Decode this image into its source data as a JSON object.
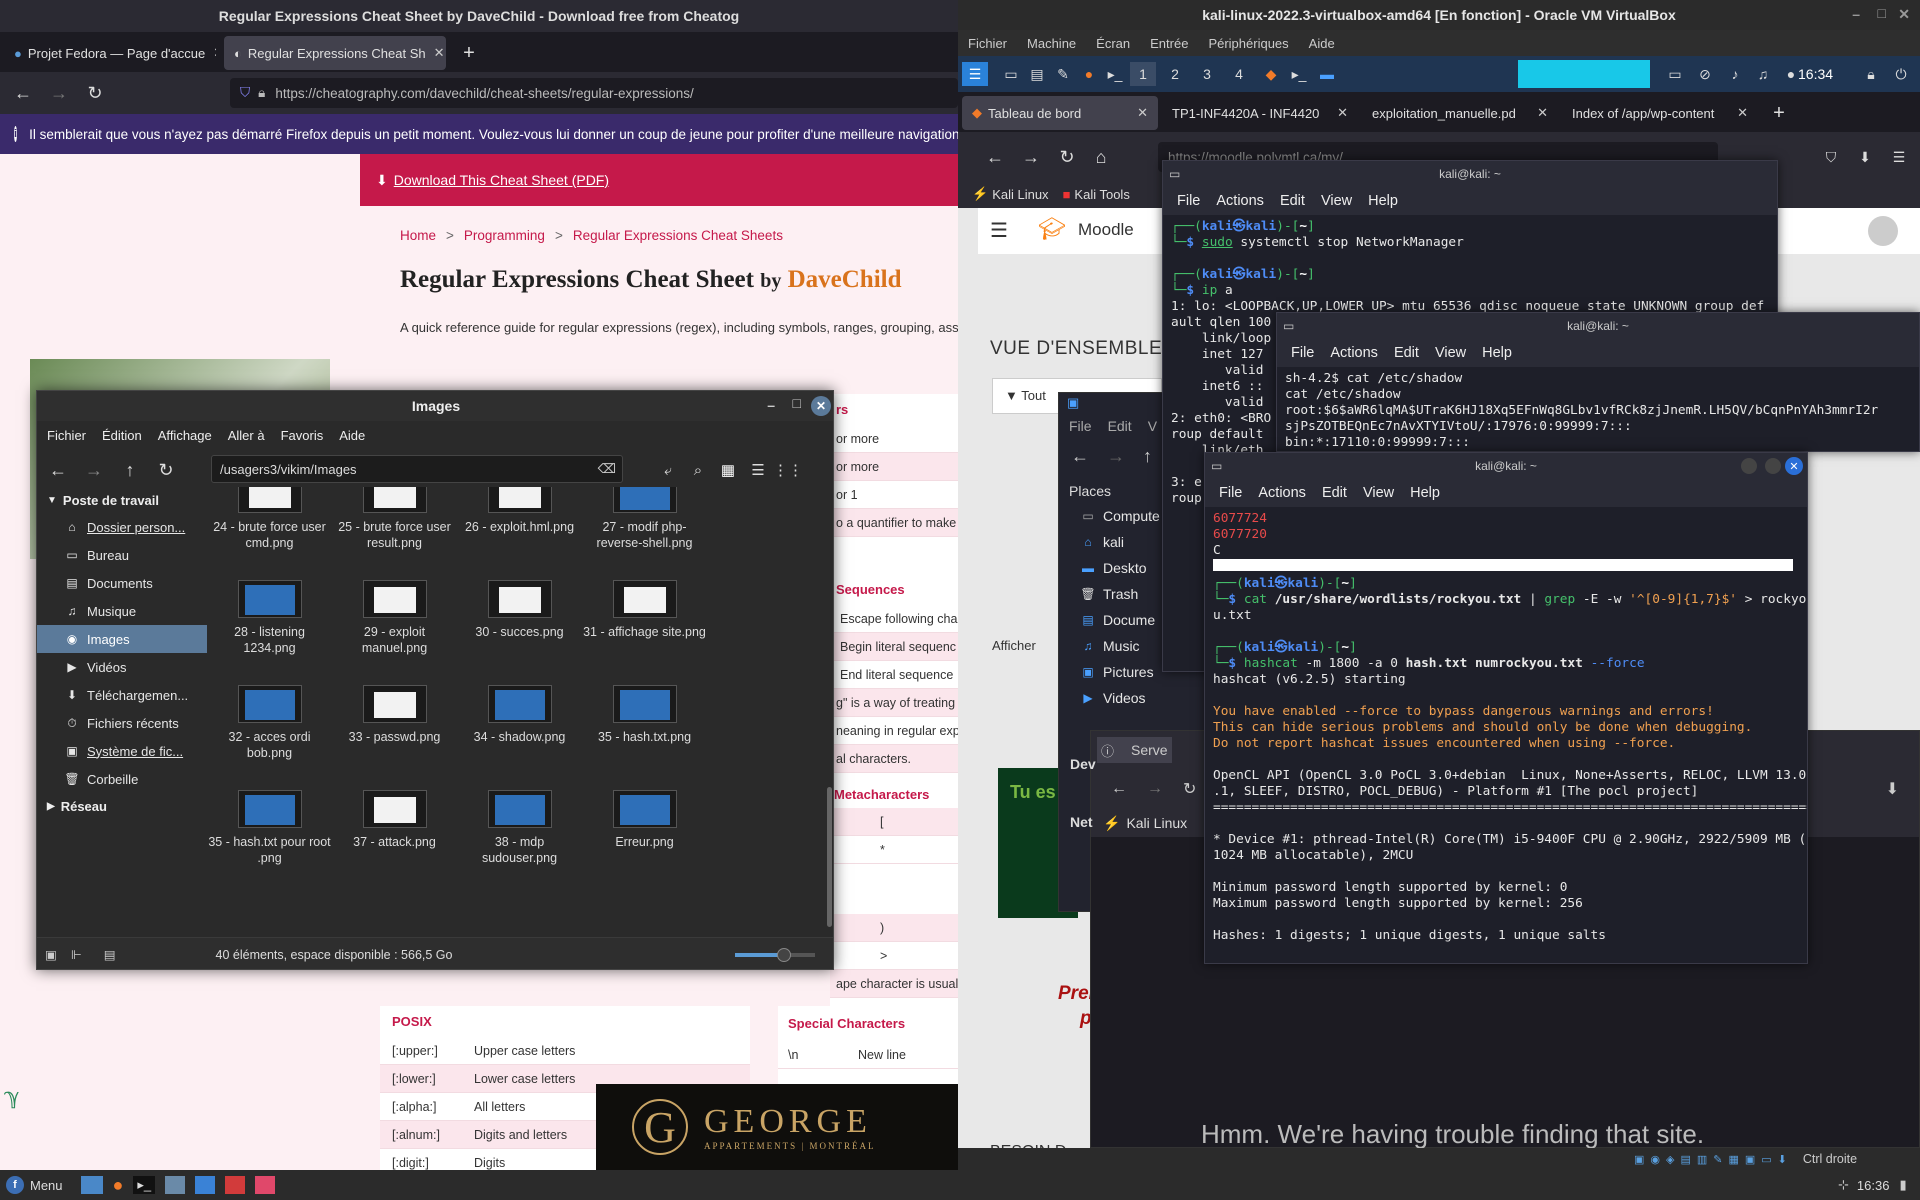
{
  "left_browser": {
    "window_title": "Regular Expressions Cheat Sheet by DaveChild - Download free from Cheatog",
    "tabs": [
      {
        "label": "Projet Fedora — Page d'accue",
        "active": false
      },
      {
        "label": "Regular Expressions Cheat Sh",
        "active": true
      }
    ],
    "url": "https://cheatography.com/davechild/cheat-sheets/regular-expressions/",
    "notification": "Il semblerait que vous n'ayez pas démarré Firefox depuis un petit moment. Voulez-vous lui donner un coup de jeune pour profiter d'une meilleure navigation ? Au f",
    "page": {
      "download_label": "Download This Cheat Sheet (PDF)",
      "breadcrumb": [
        "Home",
        "Programming",
        "Regular Expressions Cheat Sheets"
      ],
      "title": "Regular Expressions Cheat Sheet",
      "by": "by",
      "author": "DaveChild",
      "description": "A quick reference guide for regular expressions (regex), including symbols, ranges, grouping, asse",
      "partial_header_1": "rs",
      "partial_rows_1": [
        "or more",
        "or more",
        "or 1",
        "o a quantifier to make"
      ],
      "partial_header_2": "Sequences",
      "partial_rows_2": [
        "Escape following cha",
        "Begin literal sequenc",
        "End literal sequence",
        "g\" is a way of treating",
        "neaning in regular exp",
        "al characters."
      ],
      "partial_header_3": "Metacharacters",
      "partial_rows_3": [
        "[",
        "*",
        ")",
        ">"
      ],
      "partial_tail": "ape character is usual",
      "posix_header": "POSIX",
      "posix_rows": [
        [
          "[:upper:]",
          "Upper case letters"
        ],
        [
          "[:lower:]",
          "Lower case letters"
        ],
        [
          "[:alpha:]",
          "All letters"
        ],
        [
          "[:alnum:]",
          "Digits and letters"
        ],
        [
          "[:digit:]",
          "Digits"
        ]
      ],
      "special_header": "Special Characters",
      "special_rows": [
        [
          "\\n",
          "New line"
        ]
      ],
      "ad_text": "GEORGE",
      "ad_sub": "APPARTEMENTS | MONTRÉAL"
    }
  },
  "file_manager": {
    "title": "Images",
    "menu": [
      "Fichier",
      "Édition",
      "Affichage",
      "Aller à",
      "Favoris",
      "Aide"
    ],
    "path": "/usagers3/vikim/Images",
    "sidebar_head": "Poste de travail",
    "sidebar": [
      {
        "label": "Dossier person...",
        "icon": "home-icon"
      },
      {
        "label": "Bureau",
        "icon": "desktop-icon"
      },
      {
        "label": "Documents",
        "icon": "documents-icon"
      },
      {
        "label": "Musique",
        "icon": "music-icon"
      },
      {
        "label": "Images",
        "icon": "camera-icon",
        "selected": true
      },
      {
        "label": "Vidéos",
        "icon": "video-icon"
      },
      {
        "label": "Téléchargemen...",
        "icon": "download-icon"
      },
      {
        "label": "Fichiers récents",
        "icon": "recent-icon"
      },
      {
        "label": "Système de fic...",
        "icon": "drive-icon"
      },
      {
        "label": "Corbeille",
        "icon": "trash-icon"
      }
    ],
    "network": "Réseau",
    "files": [
      "24 - brute force user cmd.png",
      "25 - brute force user result.png",
      "26 - exploit.hml.png",
      "27 - modif php-reverse-shell.png",
      "28 - listening 1234.png",
      "29 - exploit manuel.png",
      "30 - succes.png",
      "31 - affichage site.png",
      "32 - acces ordi bob.png",
      "33 - passwd.png",
      "34 - shadow.png",
      "35 - hash.txt.png",
      "35 - hash.txt pour root .png",
      "37 - attack.png",
      "38 - mdp sudouser.png",
      "Erreur.png"
    ],
    "status": "40 éléments, espace disponible : 566,5 Go"
  },
  "virtualbox": {
    "title": "kali-linux-2022.3-virtualbox-amd64 [En fonction] - Oracle VM VirtualBox",
    "menu": [
      "Fichier",
      "Machine",
      "Écran",
      "Entrée",
      "Périphériques",
      "Aide"
    ],
    "workspaces": [
      "1",
      "2",
      "3",
      "4"
    ],
    "clock": "16:34",
    "firefox_tabs": [
      "Tableau de bord",
      "TP1-INF4420A - INF4420",
      "exploitation_manuelle.pd",
      "Index of /app/wp-content"
    ],
    "url": "https://moodle.polymtl.ca/my/",
    "bookmarks": [
      "Kali Linux",
      "Kali Tools"
    ],
    "moodle": {
      "brand": "Moodle",
      "overview": "VUE D'ENSEMBLE DE",
      "filter": "Tout",
      "show": "Afficher",
      "promo_line_1": "Tu es",
      "promo_red_1": "Prem",
      "promo_red_2": "p",
      "bottom": "BESOIN D",
      "error": "Hmm. We're having trouble finding that site.",
      "server": "Serve",
      "dev": "Dev",
      "net": "Net"
    },
    "thunar": {
      "menu": [
        "File",
        "Edit",
        "V"
      ],
      "places_head": "Places",
      "places": [
        "Compute",
        "kali",
        "Deskto",
        "Trash",
        "Docume",
        "Music",
        "Pictures",
        "Videos"
      ]
    },
    "status_right": "Ctrl droite"
  },
  "term1": {
    "title": "kali@kali: ~",
    "menu": [
      "File",
      "Actions",
      "Edit",
      "View",
      "Help"
    ],
    "user": "kali",
    "host": "kali",
    "dir": "~",
    "cmd1": "sudo systemctl stop NetworkManager",
    "cmd2": "ip a",
    "out": [
      "1: lo: <LOOPBACK,UP,LOWER_UP> mtu 65536 qdisc noqueue state UNKNOWN group def",
      "ault qlen 100",
      "    link/loop",
      "    inet 127",
      "       valid",
      "    inet6 ::",
      "       valid",
      "2: eth0: <BRO",
      "roup default",
      "    link/eth",
      "",
      "3: e",
      "roup"
    ]
  },
  "term2": {
    "title": "kali@kali: ~",
    "menu": [
      "File",
      "Actions",
      "Edit",
      "View",
      "Help"
    ],
    "lines": [
      "sh-4.2$ cat /etc/shadow",
      "cat /etc/shadow",
      "root:$6$aWR6lqMA$UTraK6HJ18Xq5EFnWq8GLbv1vfRCk8zjJnemR.LH5QV/bCqnPnYAh3mmrI2r",
      "sjPsZOTBEQnEc7nAvXTYIVtoU/:17976:0:99999:7:::",
      "bin:*:17110:0:99999:7:::"
    ]
  },
  "term3": {
    "title": "kali@kali: ~",
    "menu": [
      "File",
      "Actions",
      "Edit",
      "View",
      "Help"
    ],
    "top_red": [
      "6077724",
      "6077720"
    ],
    "top_white": "C",
    "cmd1": "cat /usr/share/wordlists/rockyou.txt | grep -E -w '^[0-9]{1,7}$' > rockyo",
    "cmd1_wrap": "u.txt",
    "cmd2": "hashcat -m 1800 -a 0 hash.txt numrockyou.txt --force",
    "lines": [
      "hashcat (v6.2.5) starting",
      "",
      "You have enabled --force to bypass dangerous warnings and errors!",
      "This can hide serious problems and should only be done when debugging.",
      "Do not report hashcat issues encountered when using --force.",
      "",
      "OpenCL API (OpenCL 3.0 PoCL 3.0+debian  Linux, None+Asserts, RELOC, LLVM 13.0",
      ".1, SLEEF, DISTRO, POCL_DEBUG) - Platform #1 [The pocl project]",
      "================================================================================",
      "",
      "* Device #1: pthread-Intel(R) Core(TM) i5-9400F CPU @ 2.90GHz, 2922/5909 MB (",
      "1024 MB allocatable), 2MCU",
      "",
      "Minimum password length supported by kernel: 0",
      "Maximum password length supported by kernel: 256",
      "",
      "Hashes: 1 digests; 1 unique digests, 1 unique salts"
    ]
  },
  "taskbar": {
    "menu_label": "Menu",
    "clock": "16:36"
  }
}
